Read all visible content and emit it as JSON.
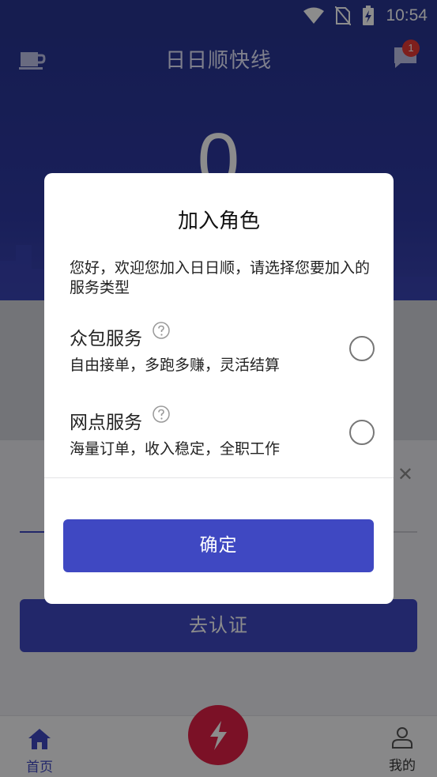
{
  "status_bar": {
    "time": "10:54"
  },
  "header": {
    "title": "日日顺快线",
    "big_value": "0",
    "badge_count": "1"
  },
  "background": {
    "verify_button": "去认证"
  },
  "bottom_nav": {
    "home_label": "首页",
    "mine_label": "我的"
  },
  "dialog": {
    "title": "加入角色",
    "description": "您好，欢迎您加入日日顺，请选择您要加入的服务类型",
    "options": [
      {
        "title": "众包服务",
        "subtitle": "自由接单，多跑多赚，灵活结算",
        "selected": false
      },
      {
        "title": "网点服务",
        "subtitle": "海量订单，收入稳定，全职工作",
        "selected": false
      }
    ],
    "confirm_label": "确定"
  },
  "colors": {
    "primary": "#3f48c2",
    "header_bg": "#283593",
    "fab": "#e02046"
  }
}
